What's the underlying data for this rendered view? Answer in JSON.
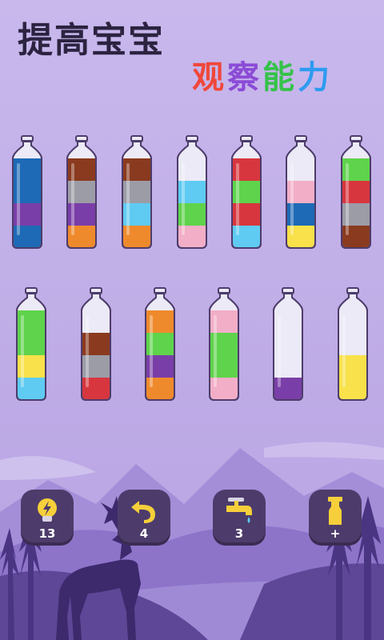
{
  "header": {
    "title_line1": "提高宝宝",
    "title_line2_chars": [
      {
        "char": "观",
        "color": "#f0473a"
      },
      {
        "char": "察",
        "color": "#8b4bd6"
      },
      {
        "char": "能",
        "color": "#35c24a"
      },
      {
        "char": "力",
        "color": "#2e9bf0"
      }
    ]
  },
  "colors": {
    "blue": "#1e6ab6",
    "purple": "#7a3ea8",
    "brown": "#8a3a1e",
    "gray": "#9c9ca6",
    "cyan": "#5fcbf2",
    "orange": "#ef8a2c",
    "green": "#5fd34c",
    "pink": "#f2aec7",
    "red": "#d8363e",
    "yellow": "#f8e14a"
  },
  "bottles_row1": [
    {
      "layers": [
        "blue",
        "blue",
        "purple",
        "blue"
      ]
    },
    {
      "layers": [
        "brown",
        "gray",
        "purple",
        "orange"
      ]
    },
    {
      "layers": [
        "brown",
        "gray",
        "cyan",
        "orange"
      ]
    },
    {
      "layers": [
        "empty",
        "cyan",
        "green",
        "pink"
      ]
    },
    {
      "layers": [
        "red",
        "green",
        "red",
        "cyan"
      ]
    },
    {
      "layers": [
        "empty",
        "pink",
        "blue",
        "yellow"
      ]
    },
    {
      "layers": [
        "green",
        "red",
        "gray",
        "brown"
      ]
    }
  ],
  "bottles_row2": [
    {
      "layers": [
        "green",
        "green",
        "yellow",
        "cyan"
      ]
    },
    {
      "layers": [
        "empty",
        "brown",
        "gray",
        "red"
      ]
    },
    {
      "layers": [
        "orange",
        "green",
        "purple",
        "orange"
      ]
    },
    {
      "layers": [
        "pink",
        "green",
        "green",
        "pink"
      ]
    },
    {
      "layers": [
        "empty",
        "empty",
        "empty",
        "purple"
      ]
    },
    {
      "layers": [
        "empty",
        "empty",
        "yellow",
        "yellow"
      ]
    }
  ],
  "buttons": [
    {
      "name": "hint",
      "icon": "lightbulb-icon",
      "count": "13"
    },
    {
      "name": "undo",
      "icon": "undo-arrow-icon",
      "count": "4"
    },
    {
      "name": "faucet",
      "icon": "faucet-icon",
      "count": "3"
    },
    {
      "name": "add-bottle",
      "icon": "add-bottle-icon",
      "count": "+"
    }
  ]
}
